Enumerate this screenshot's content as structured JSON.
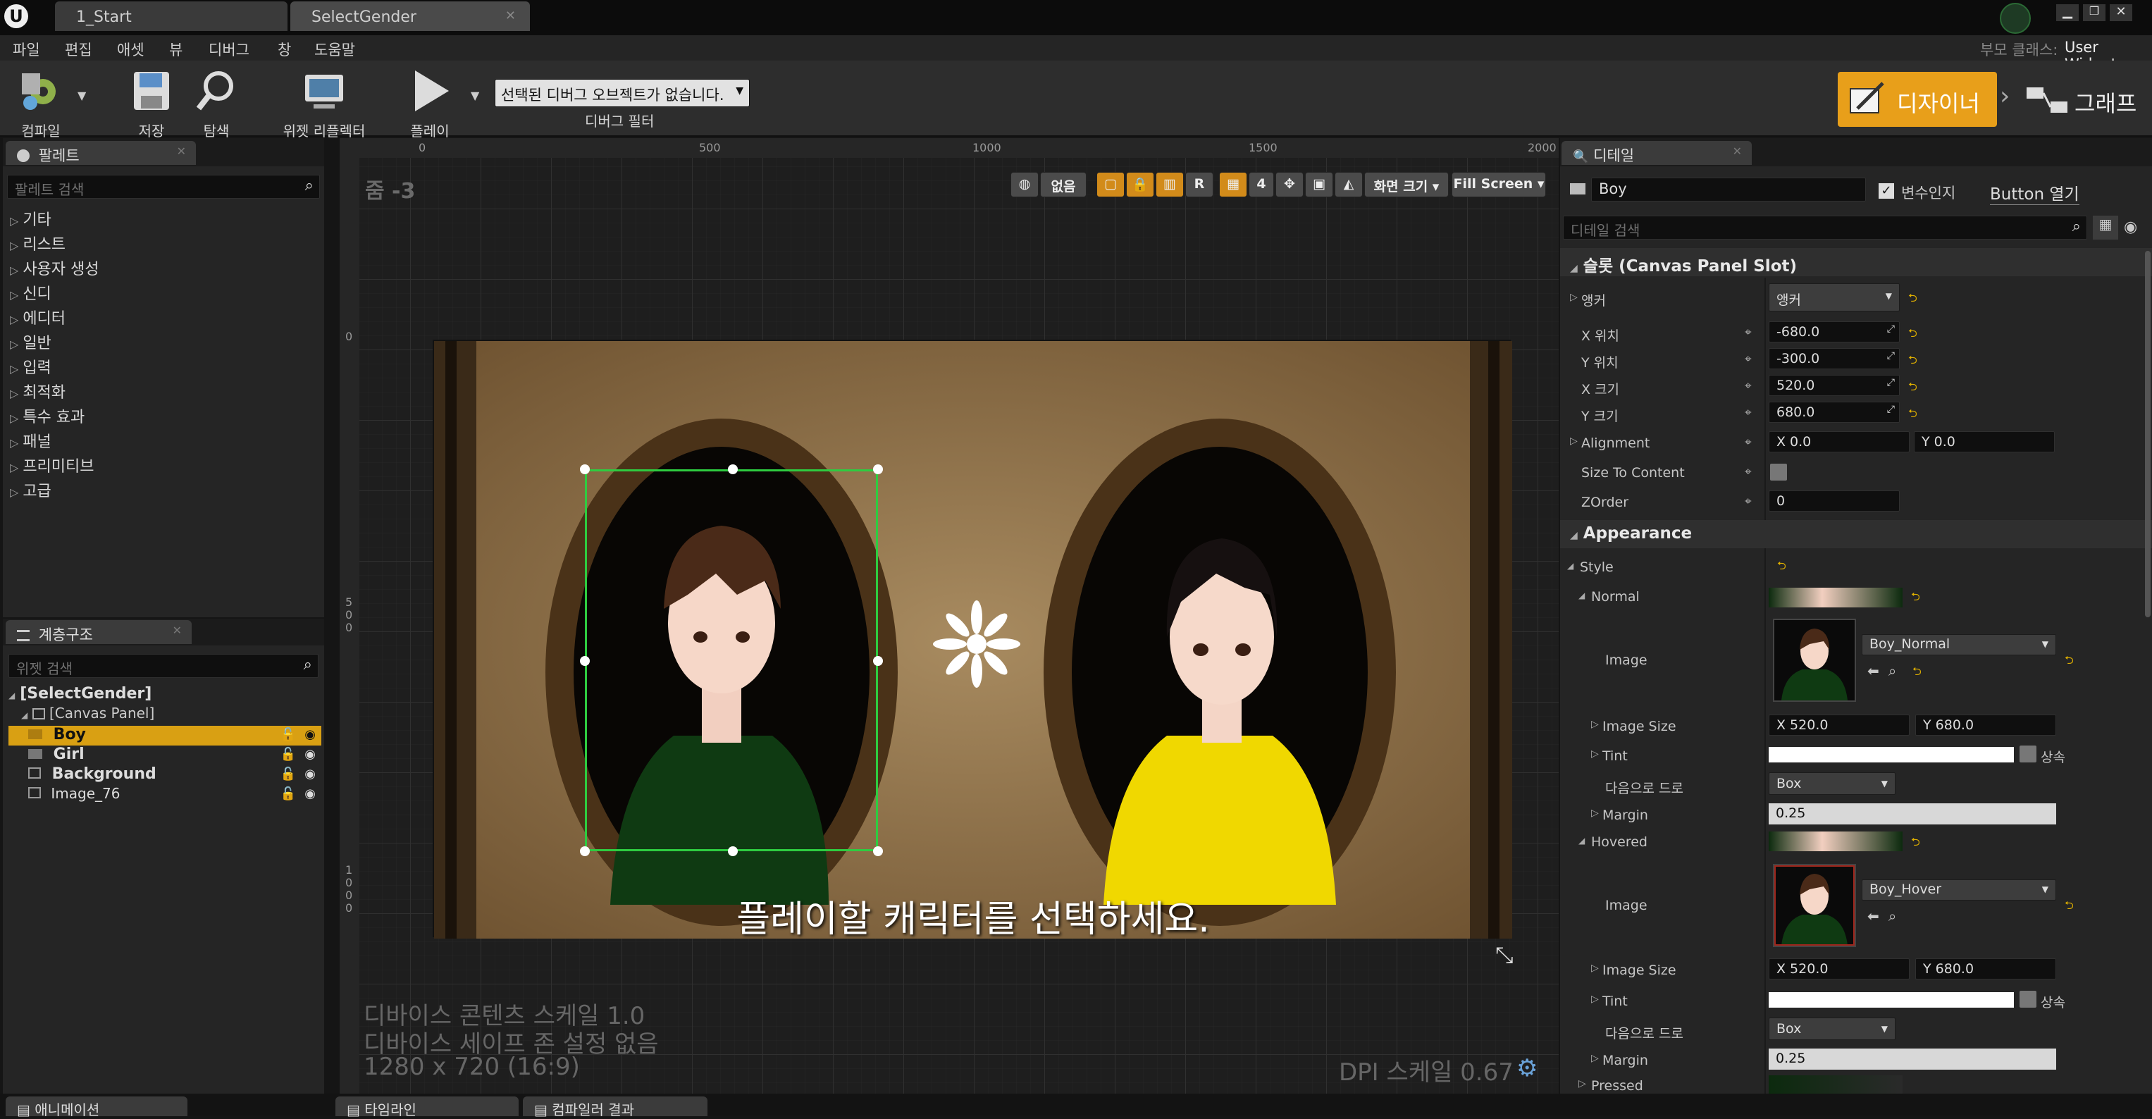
{
  "tabs": [
    {
      "label": "1_Start"
    },
    {
      "label": "SelectGender"
    }
  ],
  "parent_class": {
    "label": "부모 클래스:",
    "value": "User Widget"
  },
  "menu": [
    "파일",
    "편집",
    "애셋",
    "뷰",
    "디버그",
    "창",
    "도움말"
  ],
  "toolbar": {
    "compile": "컴파일",
    "save": "저장",
    "browse": "탐색",
    "reflector": "위젯 리플렉터",
    "play": "플레이",
    "debug_select": "선택된 디버그 오브젝트가 없습니다.",
    "debug_filter": "디버그 필터"
  },
  "mode": {
    "designer": "디자이너",
    "graph": "그래프"
  },
  "palette": {
    "tab": "팔레트",
    "search_placeholder": "팔레트 검색",
    "categories": [
      "기타",
      "리스트",
      "사용자 생성",
      "신디",
      "에디터",
      "일반",
      "입력",
      "최적화",
      "특수 효과",
      "패널",
      "프리미티브",
      "고급"
    ]
  },
  "hierarchy": {
    "tab": "계층구조",
    "search_placeholder": "위젯 검색",
    "items": [
      "[SelectGender]",
      "[Canvas Panel]",
      "Boy",
      "Girl",
      "Background",
      "Image_76"
    ]
  },
  "viewport": {
    "zoom": "줌 -3",
    "ruler_top": [
      "0",
      "500",
      "1000",
      "1500",
      "2000"
    ],
    "ruler_left": [
      "0",
      "500",
      "1000"
    ],
    "btn_none": "없음",
    "btn_r": "R",
    "btn_4": "4",
    "btn_screen": "화면 크기",
    "btn_fill": "Fill Screen",
    "caption": "플레이할 캐릭터를 선택하세요.",
    "info1": "디바이스 콘텐츠 스케일 1.0",
    "info2": "디바이스 세이프 존 설정 없음",
    "info3": "1280 x 720 (16:9)",
    "dpi": "DPI 스케일 0.67"
  },
  "bottom_tabs": [
    "애니메이션",
    "타임라인",
    "컴파일러 결과"
  ],
  "details": {
    "tab": "디테일",
    "name": "Boy",
    "is_variable": "변수인지",
    "open_button": "Button 열기",
    "search_placeholder": "디테일 검색",
    "slot_header": "슬롯 (Canvas Panel Slot)",
    "anchor_label": "앵커",
    "anchor_value": "앵커",
    "pos_x_label": "X 위치",
    "pos_x": "-680.0",
    "pos_y_label": "Y 위치",
    "pos_y": "-300.0",
    "size_x_label": "X 크기",
    "size_x": "520.0",
    "size_y_label": "Y 크기",
    "size_y": "680.0",
    "alignment_label": "Alignment",
    "align_x": "X  0.0",
    "align_y": "Y  0.0",
    "size_to_content": "Size To Content",
    "zorder_label": "ZOrder",
    "zorder": "0",
    "appearance_header": "Appearance",
    "style": "Style",
    "normal": "Normal",
    "image_label": "Image",
    "normal_image": "Boy_Normal",
    "image_size": "Image Size",
    "normal_size_x": "X  520.0",
    "normal_size_y": "Y  680.0",
    "tint": "Tint",
    "inherit": "상속",
    "draw_as": "다음으로 드로",
    "draw_as_value": "Box",
    "margin": "Margin",
    "margin_value": "0.25",
    "hovered": "Hovered",
    "hover_image": "Boy_Hover",
    "hover_size_x": "X  520.0",
    "hover_size_y": "Y  680.0",
    "pressed": "Pressed"
  },
  "colors": {
    "accent": "#e89f1a",
    "selection": "#d9a013",
    "green_outline": "#2ecc40"
  }
}
